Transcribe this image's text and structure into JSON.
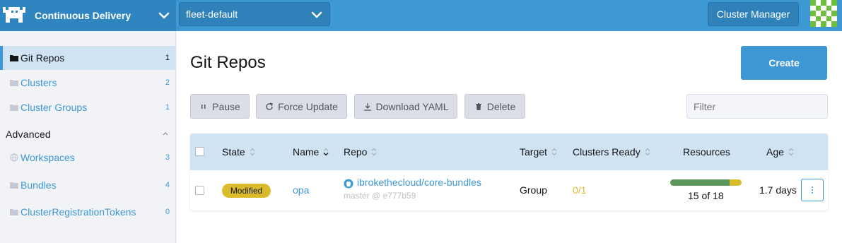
{
  "header": {
    "app_title": "Continuous Delivery",
    "namespace": "fleet-default",
    "cluster_manager_label": "Cluster Manager"
  },
  "colors": {
    "accent": "#3d98d3",
    "header": "#3d98d3",
    "sidebar_active": "#cfe3f2",
    "warning": "#dabb2c",
    "success": "#5d995d"
  },
  "sidebar": {
    "items": [
      {
        "label": "Git Repos",
        "count": "1",
        "icon": "folder-icon"
      },
      {
        "label": "Clusters",
        "count": "2",
        "icon": "folder-icon"
      },
      {
        "label": "Cluster Groups",
        "count": "1",
        "icon": "folder-icon"
      }
    ],
    "group_label": "Advanced",
    "advanced_items": [
      {
        "label": "Workspaces",
        "count": "3",
        "icon": "globe-icon"
      },
      {
        "label": "Bundles",
        "count": "4",
        "icon": "folder-icon"
      },
      {
        "label": "ClusterRegistrationTokens",
        "count": "0",
        "icon": "folder-icon"
      }
    ]
  },
  "main": {
    "title": "Git Repos",
    "create_label": "Create",
    "bulk_actions": {
      "pause": "Pause",
      "force_update": "Force Update",
      "download_yaml": "Download YAML",
      "delete": "Delete"
    },
    "filter_placeholder": "Filter"
  },
  "table": {
    "columns": [
      "State",
      "Name",
      "Repo",
      "Target",
      "Clusters Ready",
      "Resources",
      "Age"
    ],
    "rows": [
      {
        "state": "Modified",
        "name": "opa",
        "repo": "ibrokethecloud/core-bundles",
        "repo_ref": "master @ e777b59",
        "target": "Group",
        "clusters_ready": "0/1",
        "resources": "15 of 18",
        "resources_ready": 15,
        "resources_total": 18,
        "age": "1.7 days"
      }
    ]
  }
}
